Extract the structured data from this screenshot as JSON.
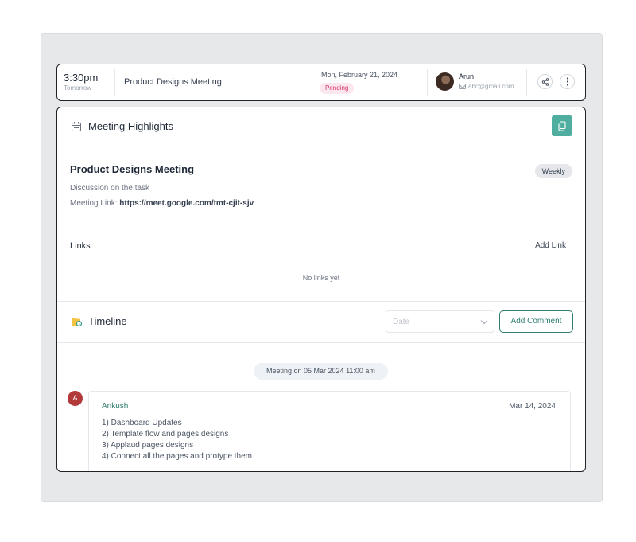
{
  "topbar": {
    "time": "3:30pm",
    "time_sub": "Tomorrow",
    "title": "Product Designs Meeting",
    "date": "Mon, February 21, 2024",
    "status": "Pending",
    "user_name": "Arun",
    "user_email": "abc@gmail.com",
    "icons": {
      "share": "share-icon",
      "more": "more-vertical-icon",
      "mail": "mail-icon"
    }
  },
  "highlights": {
    "title": "Meeting Highlights",
    "icon": "calendar-icon",
    "copy_icon": "copy-icon",
    "meeting_title": "Product Designs Meeting",
    "recurrence": "Weekly",
    "description": "Discussion on the task",
    "link_label": "Meeting Link:",
    "link_url": "https://meet.google.com/tmt-cjit-sjv"
  },
  "links": {
    "title": "Links",
    "add_label": "Add Link",
    "empty_text": "No links yet"
  },
  "timeline": {
    "title": "Timeline",
    "icon": "folder-clock-icon",
    "date_placeholder": "Date",
    "add_comment_label": "Add Comment",
    "meeting_pill": "Meeting on 05 Mar 2024 11:00 am",
    "comments": [
      {
        "avatar_letter": "A",
        "author": "Ankush",
        "date": "Mar 14, 2024",
        "lines": [
          "1) Dashboard Updates",
          "2) Template flow and pages designs",
          "3) Applaud pages designs",
          "4) Connect all the pages and protype them"
        ]
      }
    ]
  },
  "colors": {
    "accent": "#4fae9f",
    "accent_dark": "#2f7d70",
    "pending_bg": "#fde7ef",
    "pending_text": "#d6336c",
    "avatar_red": "#b23a3a"
  }
}
